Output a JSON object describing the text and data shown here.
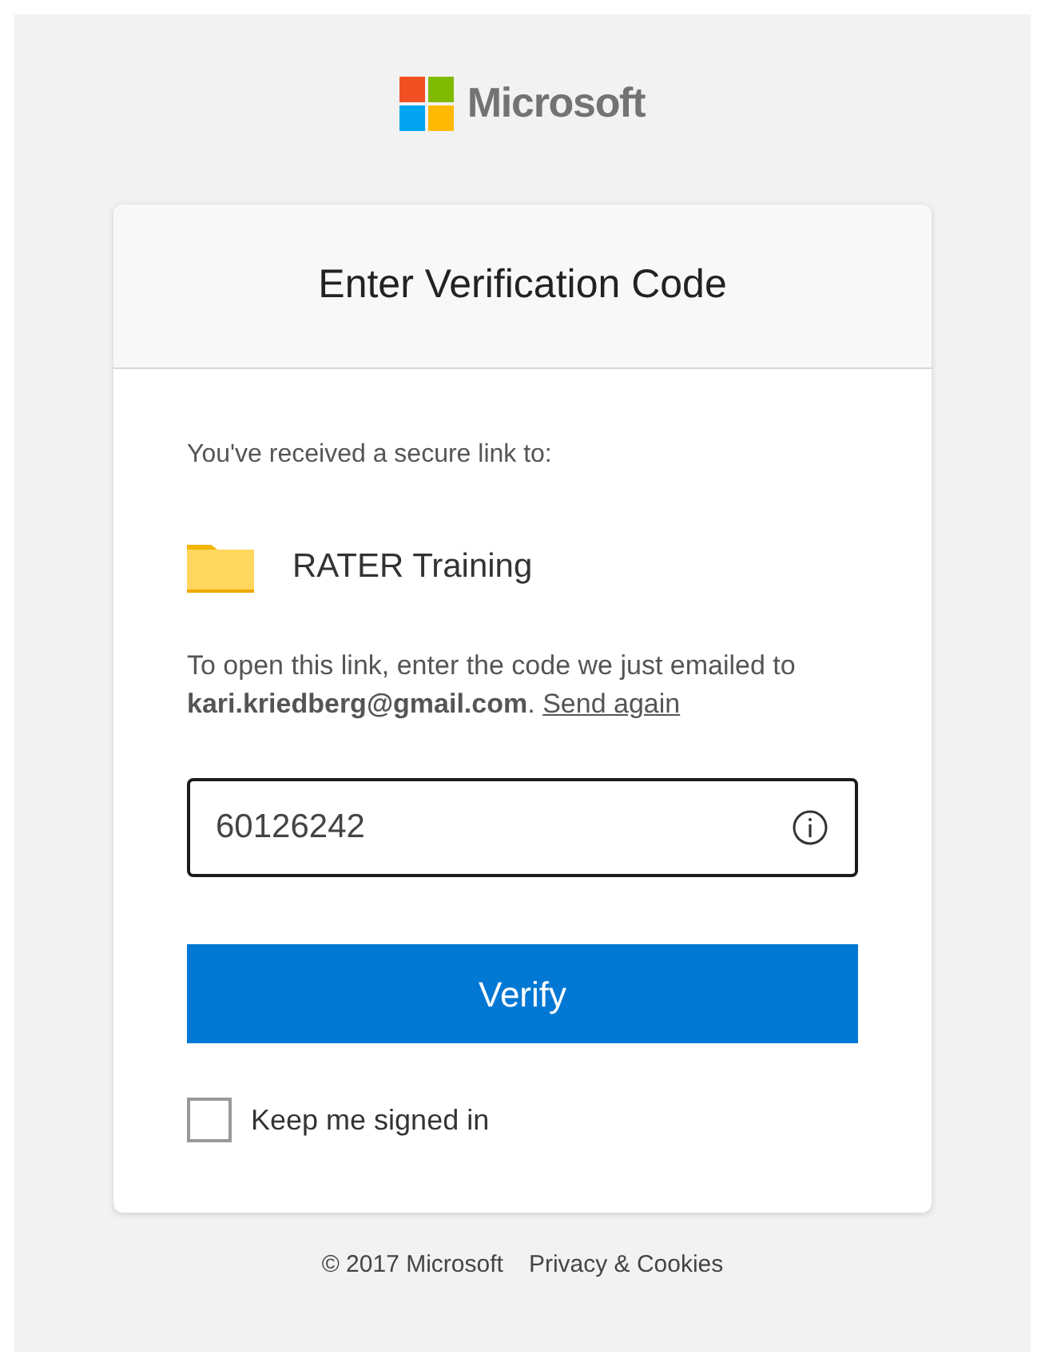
{
  "logo": {
    "text": "Microsoft"
  },
  "card": {
    "title": "Enter Verification Code",
    "intro": "You've received a secure link to:",
    "item": {
      "name": "RATER Training"
    },
    "instructions": "To open this link, enter the code we just emailed to **kari.kriedberg@gmail.com**.",
    "resend_link": "Send again",
    "code_field": {
      "value": "60126242"
    },
    "verify_button": "Verify",
    "keep_signed_in": {
      "label": "Keep me signed in",
      "checked": false
    }
  },
  "footer": {
    "copyright": "© 2017 Microsoft",
    "links": [
      "Privacy & Cookies"
    ]
  }
}
